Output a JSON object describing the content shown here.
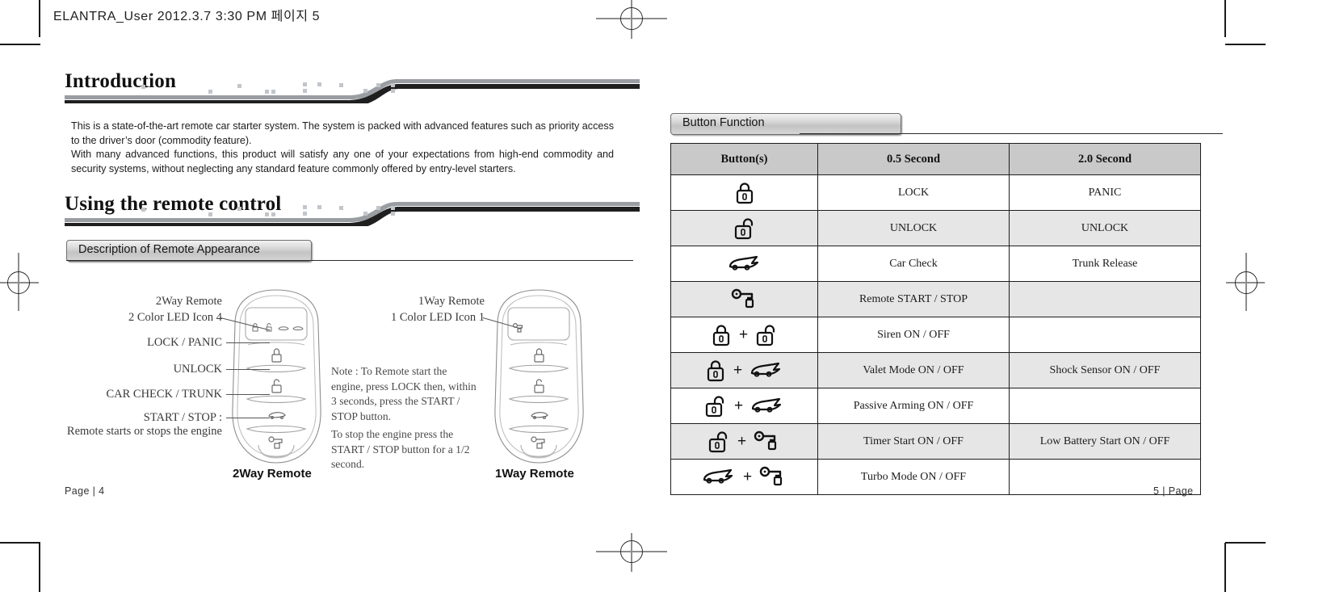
{
  "document": {
    "header_line": "ELANTRA_User  2012.3.7 3:30 PM  페이지 5"
  },
  "left_page": {
    "page_label": "Page  |  4",
    "sections": [
      {
        "title": "Introduction"
      },
      {
        "title": "Using the remote control"
      }
    ],
    "intro_paragraph_1": "This is a state-of-the-art remote car starter system. The system is packed with advanced features such as priority access to the driver’s door (commodity feature).",
    "intro_paragraph_2": "With many advanced functions, this product will satisfy any one of your expectations from high-end commodity and security systems, without neglecting any standard feature commonly offered by entry-level starters.",
    "subsection_tab": "Description of Remote Appearance",
    "two_way": {
      "caption": "2Way Remote",
      "callouts": [
        {
          "line1": "2Way Remote",
          "line2": "2 Color LED Icon 4"
        },
        {
          "line1": "LOCK / PANIC"
        },
        {
          "line1": "UNLOCK"
        },
        {
          "line1": "CAR CHECK / TRUNK"
        },
        {
          "line1": "START / STOP :",
          "line2": "Remote starts or stops the engine"
        }
      ]
    },
    "one_way": {
      "caption": "1Way Remote",
      "callout": {
        "line1": "1Way Remote",
        "line2": "1 Color LED Icon 1"
      },
      "note_1": "Note : To Remote start the engine, press LOCK then, within 3 seconds, press the START / STOP button.",
      "note_2": "To stop the engine press the START / STOP button for a 1/2 second."
    }
  },
  "right_page": {
    "page_label": "5  |  Page",
    "subsection_tab": "Button Function",
    "table": {
      "headers": [
        "Button(s)",
        "0.5 Second",
        "2.0 Second"
      ],
      "rows": [
        {
          "icons": [
            "lock-icon"
          ],
          "half_second": "LOCK",
          "two_second": "PANIC"
        },
        {
          "icons": [
            "unlock-icon"
          ],
          "half_second": "UNLOCK",
          "two_second": "UNLOCK"
        },
        {
          "icons": [
            "car-icon"
          ],
          "half_second": "Car Check",
          "two_second": "Trunk Release"
        },
        {
          "icons": [
            "key-icon"
          ],
          "half_second": "Remote START / STOP",
          "two_second": ""
        },
        {
          "icons": [
            "lock-icon",
            "unlock-icon"
          ],
          "half_second": "Siren ON / OFF",
          "two_second": ""
        },
        {
          "icons": [
            "lock-icon",
            "car-icon"
          ],
          "half_second": "Valet Mode ON / OFF",
          "two_second": "Shock Sensor ON / OFF"
        },
        {
          "icons": [
            "unlock-icon",
            "car-icon"
          ],
          "half_second": "Passive Arming ON / OFF",
          "two_second": ""
        },
        {
          "icons": [
            "unlock-icon",
            "key-icon"
          ],
          "half_second": "Timer Start ON / OFF",
          "two_second": "Low Battery Start ON / OFF"
        },
        {
          "icons": [
            "car-icon",
            "key-icon"
          ],
          "half_second": "Turbo Mode ON / OFF",
          "two_second": ""
        }
      ],
      "icon_separator": "+"
    }
  },
  "colors": {
    "header_bar_dark": "#1f1f1f",
    "header_bar_grey": "#9a9ea3",
    "table_header_bg": "#c9c9c9",
    "table_alt_row_bg": "#e6e6e6",
    "rule": "#1d1d1d"
  }
}
